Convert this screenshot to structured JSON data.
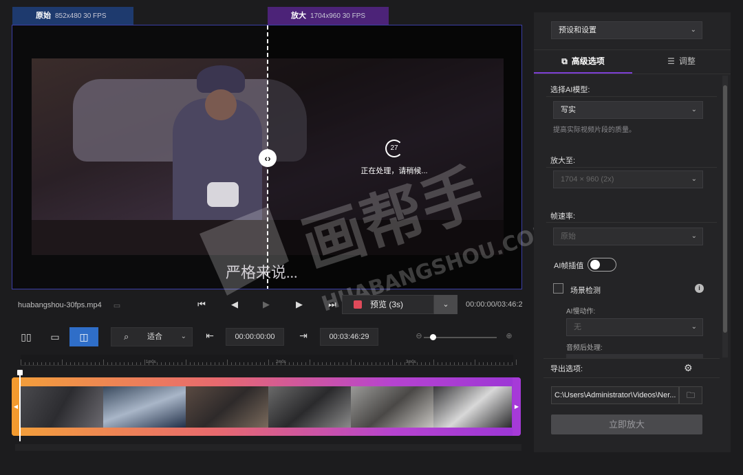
{
  "video_tabs": {
    "original_label": "原始",
    "original_info": "852x480 30 FPS",
    "upscaled_label": "放大",
    "upscaled_info": "1704x960 30 FPS"
  },
  "preview": {
    "progress_number": "27",
    "processing_text": "正在处理，请稍候...",
    "subtitle_text": "严格来说..."
  },
  "watermark": {
    "brand_cn": "画帮手",
    "brand_en": "HUABANGSHOU.COM"
  },
  "player": {
    "file_name": "huabangshou-30fps.mp4",
    "preview_label": "预览 (3s)",
    "timecode": "00:00:00/03:46:29"
  },
  "toolbar": {
    "zoom_label": "适合",
    "time_in": "00:00:00:00",
    "time_out": "00:03:46:29",
    "zoom_level": 0.12
  },
  "timeline": {
    "ruler_labels": [
      "1m0s",
      "2m0s",
      "3m0s"
    ]
  },
  "panel": {
    "preset_label": "预设和设置",
    "tab_advanced": "高级选项",
    "tab_adjust": "调整",
    "model_heading": "选择AI模型:",
    "model_value": "写实",
    "model_desc": "提高实际视频片段的质量。",
    "upscale_heading": "放大至:",
    "upscale_value": "1704 × 960 (2x)",
    "framerate_heading": "帧速率:",
    "framerate_value": "原始",
    "ai_interp_label": "AI帧插值",
    "ai_interp_on": false,
    "scene_detect_label": "场景检测",
    "scene_detect_checked": false,
    "slowmo_heading": "AI慢动作:",
    "slowmo_value": "无",
    "audio_heading": "音频后处理:",
    "export_heading": "导出选项:",
    "export_path": "C:\\Users\\Administrator\\Videos\\Ner...",
    "start_button": "立即放大"
  },
  "colors": {
    "accent_purple": "#7d3fd6",
    "accent_blue": "#2f6ec8",
    "track_orange": "#f39a2f",
    "track_purple": "#a63ad8"
  }
}
